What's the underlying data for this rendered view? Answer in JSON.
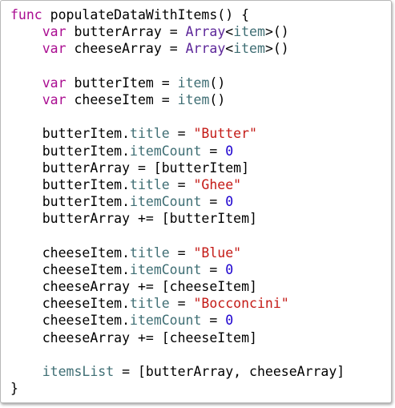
{
  "editor": {
    "theme_colors": {
      "keyword": "#aa0d91",
      "type": "#5c2699",
      "property": "#3f6e74",
      "string": "#c41a16",
      "number": "#1c00cf",
      "plain": "#000000"
    },
    "lines": [
      [
        {
          "t": "func",
          "c": "kw"
        },
        {
          "t": " populateDataWithItems() {",
          "c": "pl"
        }
      ],
      [
        {
          "t": "    ",
          "c": "pl"
        },
        {
          "t": "var",
          "c": "kw"
        },
        {
          "t": " butterArray = ",
          "c": "pl"
        },
        {
          "t": "Array",
          "c": "typ"
        },
        {
          "t": "<",
          "c": "pl"
        },
        {
          "t": "item",
          "c": "prop"
        },
        {
          "t": ">()",
          "c": "pl"
        }
      ],
      [
        {
          "t": "    ",
          "c": "pl"
        },
        {
          "t": "var",
          "c": "kw"
        },
        {
          "t": " cheeseArray = ",
          "c": "pl"
        },
        {
          "t": "Array",
          "c": "typ"
        },
        {
          "t": "<",
          "c": "pl"
        },
        {
          "t": "item",
          "c": "prop"
        },
        {
          "t": ">()",
          "c": "pl"
        }
      ],
      [],
      [
        {
          "t": "    ",
          "c": "pl"
        },
        {
          "t": "var",
          "c": "kw"
        },
        {
          "t": " butterItem = ",
          "c": "pl"
        },
        {
          "t": "item",
          "c": "prop"
        },
        {
          "t": "()",
          "c": "pl"
        }
      ],
      [
        {
          "t": "    ",
          "c": "pl"
        },
        {
          "t": "var",
          "c": "kw"
        },
        {
          "t": " cheeseItem = ",
          "c": "pl"
        },
        {
          "t": "item",
          "c": "prop"
        },
        {
          "t": "()",
          "c": "pl"
        }
      ],
      [],
      [
        {
          "t": "    butterItem.",
          "c": "pl"
        },
        {
          "t": "title",
          "c": "prop"
        },
        {
          "t": " = ",
          "c": "pl"
        },
        {
          "t": "\"Butter\"",
          "c": "str"
        }
      ],
      [
        {
          "t": "    butterItem.",
          "c": "pl"
        },
        {
          "t": "itemCount",
          "c": "prop"
        },
        {
          "t": " = ",
          "c": "pl"
        },
        {
          "t": "0",
          "c": "num"
        }
      ],
      [
        {
          "t": "    butterArray = [butterItem]",
          "c": "pl"
        }
      ],
      [
        {
          "t": "    butterItem.",
          "c": "pl"
        },
        {
          "t": "title",
          "c": "prop"
        },
        {
          "t": " = ",
          "c": "pl"
        },
        {
          "t": "\"Ghee\"",
          "c": "str"
        }
      ],
      [
        {
          "t": "    butterItem.",
          "c": "pl"
        },
        {
          "t": "itemCount",
          "c": "prop"
        },
        {
          "t": " = ",
          "c": "pl"
        },
        {
          "t": "0",
          "c": "num"
        }
      ],
      [
        {
          "t": "    butterArray += [butterItem]",
          "c": "pl"
        }
      ],
      [],
      [
        {
          "t": "    cheeseItem.",
          "c": "pl"
        },
        {
          "t": "title",
          "c": "prop"
        },
        {
          "t": " = ",
          "c": "pl"
        },
        {
          "t": "\"Blue\"",
          "c": "str"
        }
      ],
      [
        {
          "t": "    cheeseItem.",
          "c": "pl"
        },
        {
          "t": "itemCount",
          "c": "prop"
        },
        {
          "t": " = ",
          "c": "pl"
        },
        {
          "t": "0",
          "c": "num"
        }
      ],
      [
        {
          "t": "    cheeseArray += [cheeseItem]",
          "c": "pl"
        }
      ],
      [
        {
          "t": "    cheeseItem.",
          "c": "pl"
        },
        {
          "t": "title",
          "c": "prop"
        },
        {
          "t": " = ",
          "c": "pl"
        },
        {
          "t": "\"Bocconcini\"",
          "c": "str"
        }
      ],
      [
        {
          "t": "    cheeseItem.",
          "c": "pl"
        },
        {
          "t": "itemCount",
          "c": "prop"
        },
        {
          "t": " = ",
          "c": "pl"
        },
        {
          "t": "0",
          "c": "num"
        }
      ],
      [
        {
          "t": "    cheeseArray += [cheeseItem]",
          "c": "pl"
        }
      ],
      [],
      [
        {
          "t": "    ",
          "c": "pl"
        },
        {
          "t": "itemsList",
          "c": "prop"
        },
        {
          "t": " = [butterArray, cheeseArray]",
          "c": "pl"
        }
      ],
      [
        {
          "t": "}",
          "c": "pl"
        }
      ]
    ]
  }
}
